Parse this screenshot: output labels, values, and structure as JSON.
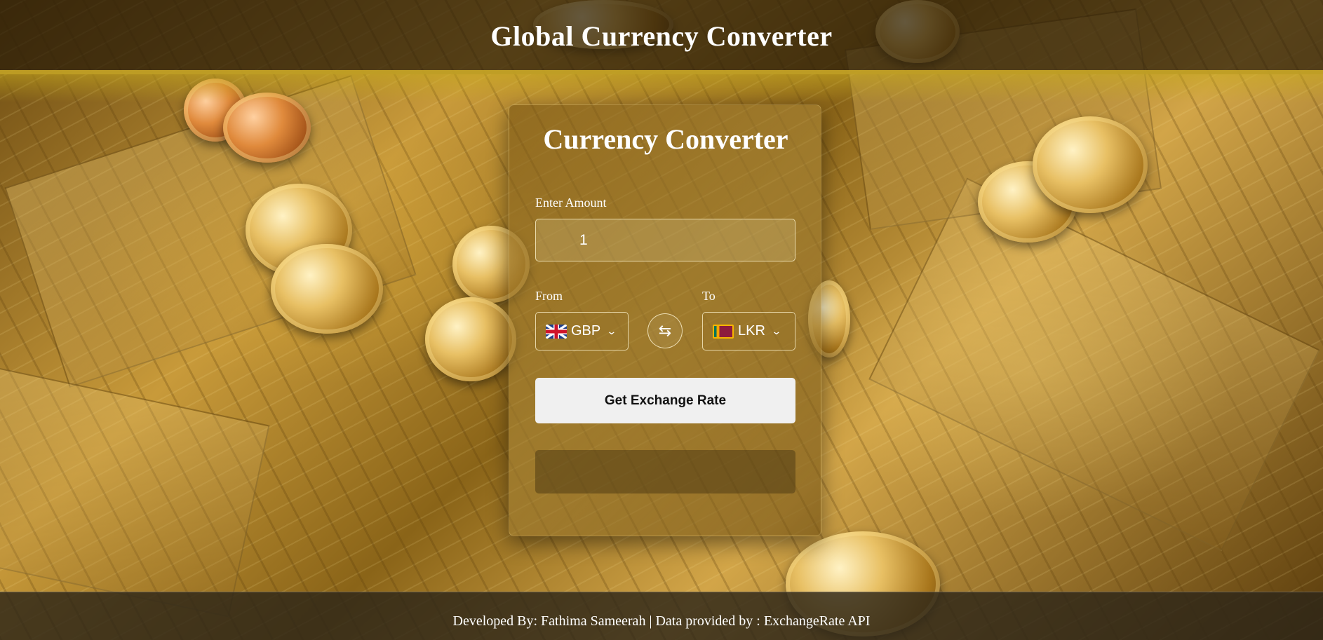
{
  "header": {
    "title": "Global Currency Converter"
  },
  "converter": {
    "title": "Currency Converter",
    "amount_label": "Enter Amount",
    "amount_value": "1",
    "from_label": "From",
    "to_label": "To",
    "from_currency": "GBP",
    "to_currency": "LKR",
    "from_flag_icon": "uk-flag-icon",
    "to_flag_icon": "sri-lanka-flag-icon",
    "swap_icon": "swap-arrows-icon",
    "button_label": "Get Exchange Rate",
    "result_text": ""
  },
  "footer": {
    "text": "Developed By: Fathima Sameerah | Data provided by : ExchangeRate API"
  },
  "colors": {
    "header_accent": "#d2af28",
    "button_bg": "#f0f0f0"
  }
}
